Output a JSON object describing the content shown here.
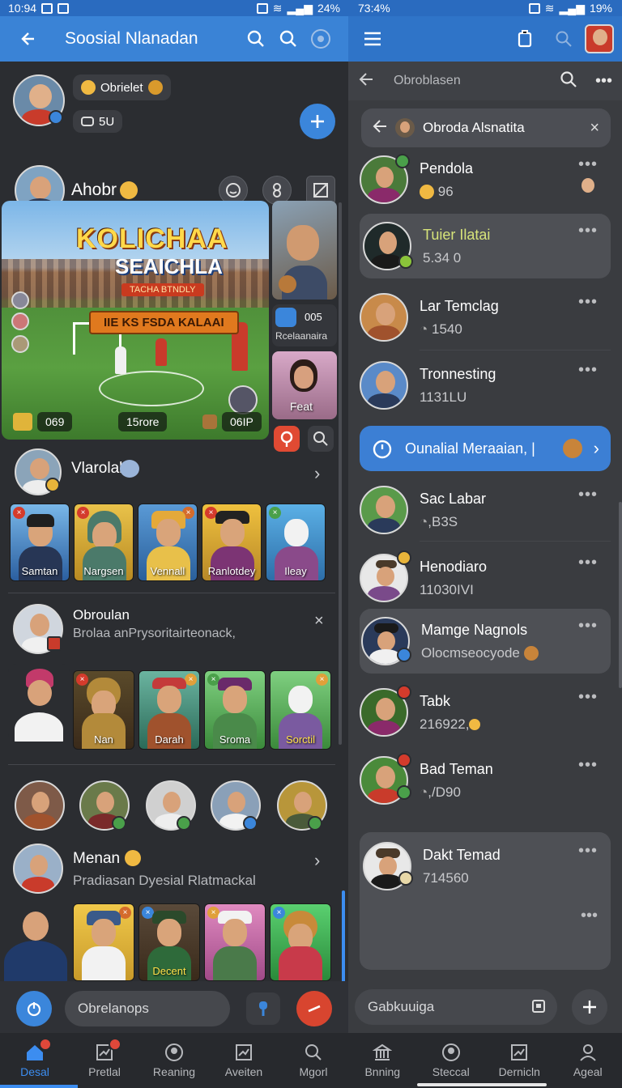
{
  "status_left": {
    "time": "10:94",
    "right": "24%"
  },
  "status_right": {
    "time": "73:4%",
    "right": "19%"
  },
  "left_panel": {
    "title": "Soosial Nlanadan",
    "profile": {
      "chip_name": "Obrielet",
      "chip_count": "5U"
    },
    "group": {
      "name": "Ahobr"
    },
    "banner": {
      "logo_line1": "KOLICHAA",
      "logo_line2": "SEAICHLA",
      "small_ribbon": "TACHA BTNDLY",
      "ribbon": "IIE KS FSDA KALAAI",
      "stat_left": "069",
      "stat_mid": "15rore",
      "stat_right": "06IP"
    },
    "side_tiles": {
      "count": "005",
      "caption": "Rcelaanaira",
      "name": "Feat"
    },
    "row1": {
      "title": "Vlarolal"
    },
    "cards1": [
      "Samtan",
      "Nargsen",
      "Vennall",
      "Ranlotdey",
      "Ileay"
    ],
    "row2": {
      "title": "Obroulan",
      "sub": "Brolaa anPrysoritairteonack,"
    },
    "cards2": [
      "Nan",
      "Darah",
      "Sroma",
      "Sorctil"
    ],
    "row3": {
      "title": "Menan",
      "sub": "Pradiasan Dyesial Rlatmackal"
    },
    "input_placeholder": "Obrelanops"
  },
  "right_panel": {
    "search_text": "Obroblasen",
    "filter_chip": "Obroda Alsnatita",
    "items": [
      {
        "name": "Pendola",
        "sub": "96"
      },
      {
        "name": "Tuier Ilatai",
        "sub": "5.34 0"
      },
      {
        "name": "Lar Temclag",
        "sub": "1540"
      },
      {
        "name": "Tronnesting",
        "sub": "1131LU"
      },
      {
        "name": "Sac Labar",
        "sub": ",B3S"
      },
      {
        "name": "Henodiaro",
        "sub": "11030IVI"
      },
      {
        "name": "Mamge Nagnols",
        "sub": "Olocmseocyode"
      },
      {
        "name": "Tabk",
        "sub": "216922,"
      },
      {
        "name": "Bad Teman",
        "sub": ",/D90"
      },
      {
        "name": "Dakt Temad",
        "sub": "714560"
      }
    ],
    "promo": "Ounalial Meraaian, |",
    "input_placeholder": "Gabkuuiga"
  },
  "nav_left": [
    "Desal",
    "Pretlal",
    "Reaning",
    "Aveiten",
    "Mgorl"
  ],
  "nav_right": [
    "Bnning",
    "Steccal",
    "Dernicln",
    "Ageal"
  ],
  "colors": {
    "accent": "#3a83d6",
    "bg": "#2b2d31",
    "highlight": "#4e5055"
  }
}
